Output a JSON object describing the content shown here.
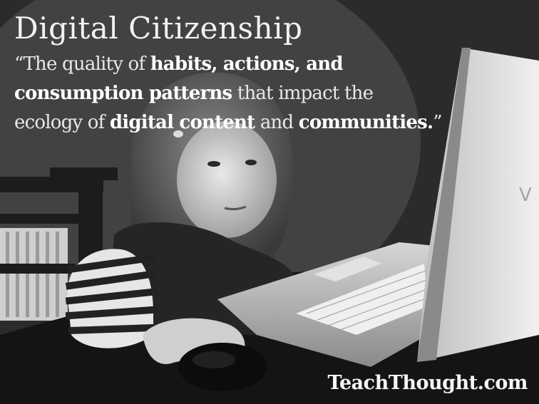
{
  "title": "Digital Citizenship",
  "quote": {
    "open_mark": "“",
    "t1": "The quality of ",
    "b1": "habits, actions, and",
    "b2": "consumption patterns",
    "t2": " that impact the",
    "t3": "ecology of ",
    "b3": "digital content",
    "t4": " and ",
    "b4": "communities.",
    "close_mark": "”"
  },
  "brand": "TeachThought.com",
  "laptop_logo": "V",
  "colors": {
    "title_text": "#f2f2f2",
    "bold_text": "#ffffff",
    "background": "#2e2e2e",
    "laptop": "#c8c8c8"
  }
}
